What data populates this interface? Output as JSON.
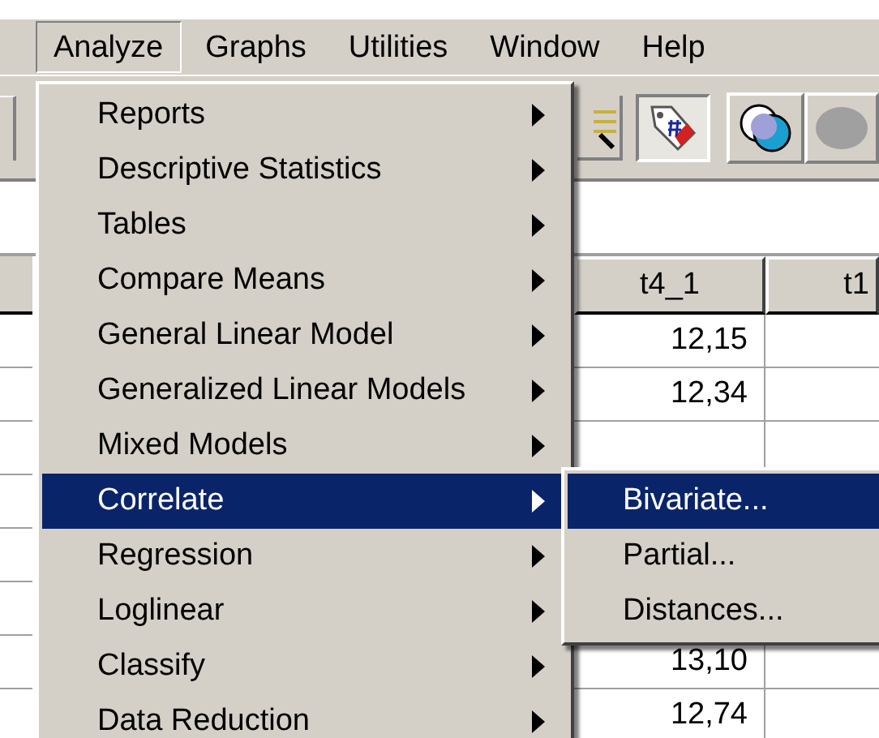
{
  "menubar": [
    {
      "label": "Analyze",
      "selected": true
    },
    {
      "label": "Graphs",
      "selected": false
    },
    {
      "label": "Utilities",
      "selected": false
    },
    {
      "label": "Window",
      "selected": false
    },
    {
      "label": "Help",
      "selected": false
    }
  ],
  "table": {
    "columns": [
      "t4_1",
      "t1"
    ],
    "rows": [
      {
        "t4_1": "12,15"
      },
      {
        "t4_1": "12,34"
      },
      {},
      {},
      {},
      {},
      {
        "t4_1": "13,10"
      },
      {
        "t4_1": "12,74"
      }
    ]
  },
  "menu": [
    {
      "label": "Reports",
      "selected": false
    },
    {
      "label": "Descriptive Statistics",
      "selected": false
    },
    {
      "label": "Tables",
      "selected": false
    },
    {
      "label": "Compare Means",
      "selected": false
    },
    {
      "label": "General Linear Model",
      "selected": false
    },
    {
      "label": "Generalized Linear Models",
      "selected": false
    },
    {
      "label": "Mixed Models",
      "selected": false
    },
    {
      "label": "Correlate",
      "selected": true
    },
    {
      "label": "Regression",
      "selected": false
    },
    {
      "label": "Loglinear",
      "selected": false
    },
    {
      "label": "Classify",
      "selected": false
    },
    {
      "label": "Data Reduction",
      "selected": false
    }
  ],
  "submenu": [
    {
      "label": "Bivariate...",
      "selected": true
    },
    {
      "label": "Partial...",
      "selected": false
    },
    {
      "label": "Distances...",
      "selected": false
    }
  ]
}
